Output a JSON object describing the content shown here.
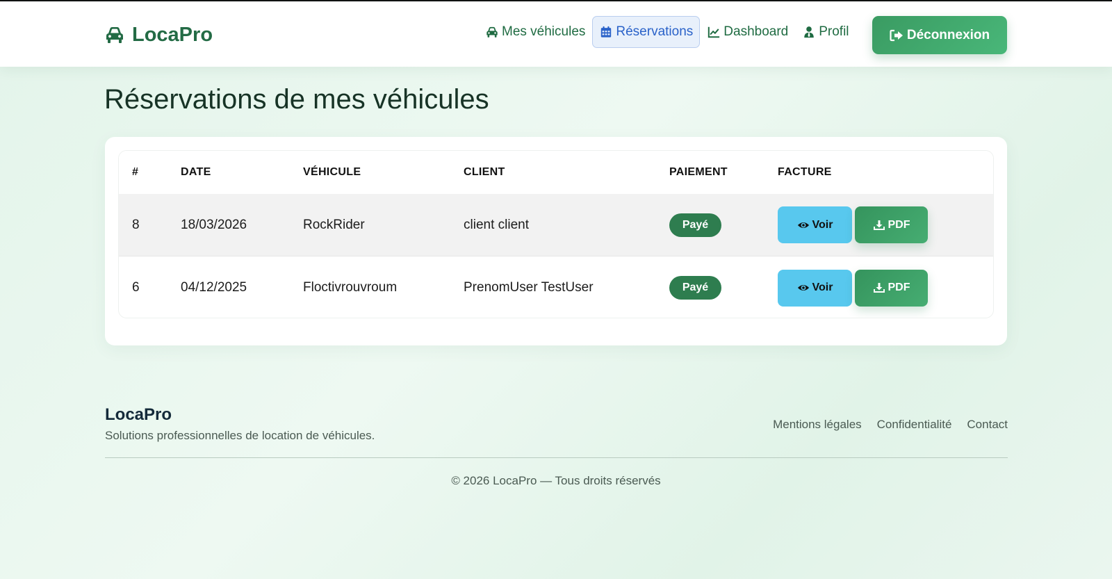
{
  "header": {
    "brand": "LocaPro",
    "nav": [
      {
        "label": "Mes véhicules",
        "icon": "car-icon"
      },
      {
        "label": "Réservations",
        "icon": "calendar-icon",
        "active": true
      },
      {
        "label": "Dashboard",
        "icon": "chart-line-icon"
      },
      {
        "label": "Profil",
        "icon": "user-tie-icon"
      }
    ],
    "logout_label": "Déconnexion"
  },
  "page": {
    "title": "Réservations de mes véhicules"
  },
  "table": {
    "columns": [
      "#",
      "DATE",
      "VÉHICULE",
      "CLIENT",
      "PAIEMENT",
      "FACTURE"
    ],
    "rows": [
      {
        "id": "8",
        "date": "18/03/2026",
        "vehicle": "RockRider",
        "client": "client client",
        "payment": "Payé",
        "view_label": "Voir",
        "pdf_label": "PDF"
      },
      {
        "id": "6",
        "date": "04/12/2025",
        "vehicle": "Floctivrouvroum",
        "client": "PrenomUser TestUser",
        "payment": "Payé",
        "view_label": "Voir",
        "pdf_label": "PDF"
      }
    ]
  },
  "footer": {
    "brand": "LocaPro",
    "tagline": "Solutions professionnelles de location de véhicules.",
    "links": [
      "Mentions légales",
      "Confidentialité",
      "Contact"
    ],
    "copyright": "© 2026 LocaPro — Tous droits réservés"
  },
  "colors": {
    "primary_green": "#2e7d4f",
    "brand_green": "#236b45",
    "active_nav_blue": "#2a62c9",
    "voir_button": "#58c8ee"
  }
}
